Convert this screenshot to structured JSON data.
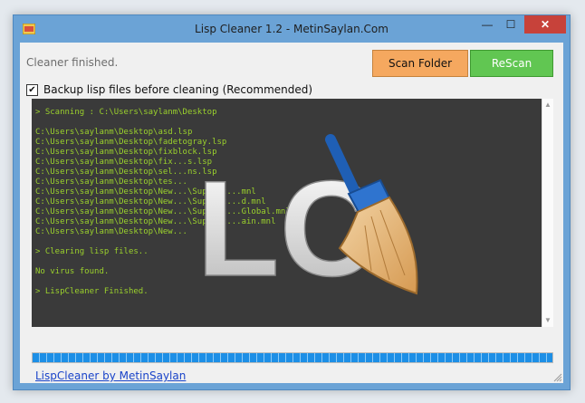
{
  "window": {
    "title": "Lisp Cleaner 1.2 - MetinSaylan.Com"
  },
  "titlebar": {
    "minimize": "—",
    "maximize": "☐",
    "close": "✕"
  },
  "status": "Cleaner finished.",
  "buttons": {
    "scan": "Scan Folder",
    "rescan": "ReScan"
  },
  "backup": {
    "checked": "✔",
    "label": "Backup lisp files before cleaning (Recommended)"
  },
  "console": {
    "lines": [
      "> Scanning : C:\\Users\\saylanm\\Desktop",
      "",
      "C:\\Users\\saylanm\\Desktop\\asd.lsp",
      "C:\\Users\\saylanm\\Desktop\\fadetogray.lsp",
      "C:\\Users\\saylanm\\Desktop\\fixblock.lsp",
      "C:\\Users\\saylanm\\Desktop\\fix...s.lsp",
      "C:\\Users\\saylanm\\Desktop\\sel...ns.lsp",
      "C:\\Users\\saylanm\\Desktop\\tes...",
      "C:\\Users\\saylanm\\Desktop\\New...\\Support...mnl",
      "C:\\Users\\saylanm\\Desktop\\New...\\Support...d.mnl",
      "C:\\Users\\saylanm\\Desktop\\New...\\Support...Global.mnl",
      "C:\\Users\\saylanm\\Desktop\\New...\\Support...ain.mnl",
      "C:\\Users\\saylanm\\Desktop\\New...",
      "",
      "> Clearing lisp files..",
      "",
      "No virus found.",
      "",
      "> LispCleaner Finished."
    ]
  },
  "logo": {
    "text": "LC"
  },
  "progress": {
    "percent": 100
  },
  "footer": {
    "link": "LispCleaner by MetinSaylan"
  },
  "colors": {
    "console_text": "#9bd12c",
    "console_bg": "#3a3a3a",
    "scan_button": "#f5a85f",
    "rescan_button": "#61c652",
    "progress": "#1d8fe6"
  }
}
